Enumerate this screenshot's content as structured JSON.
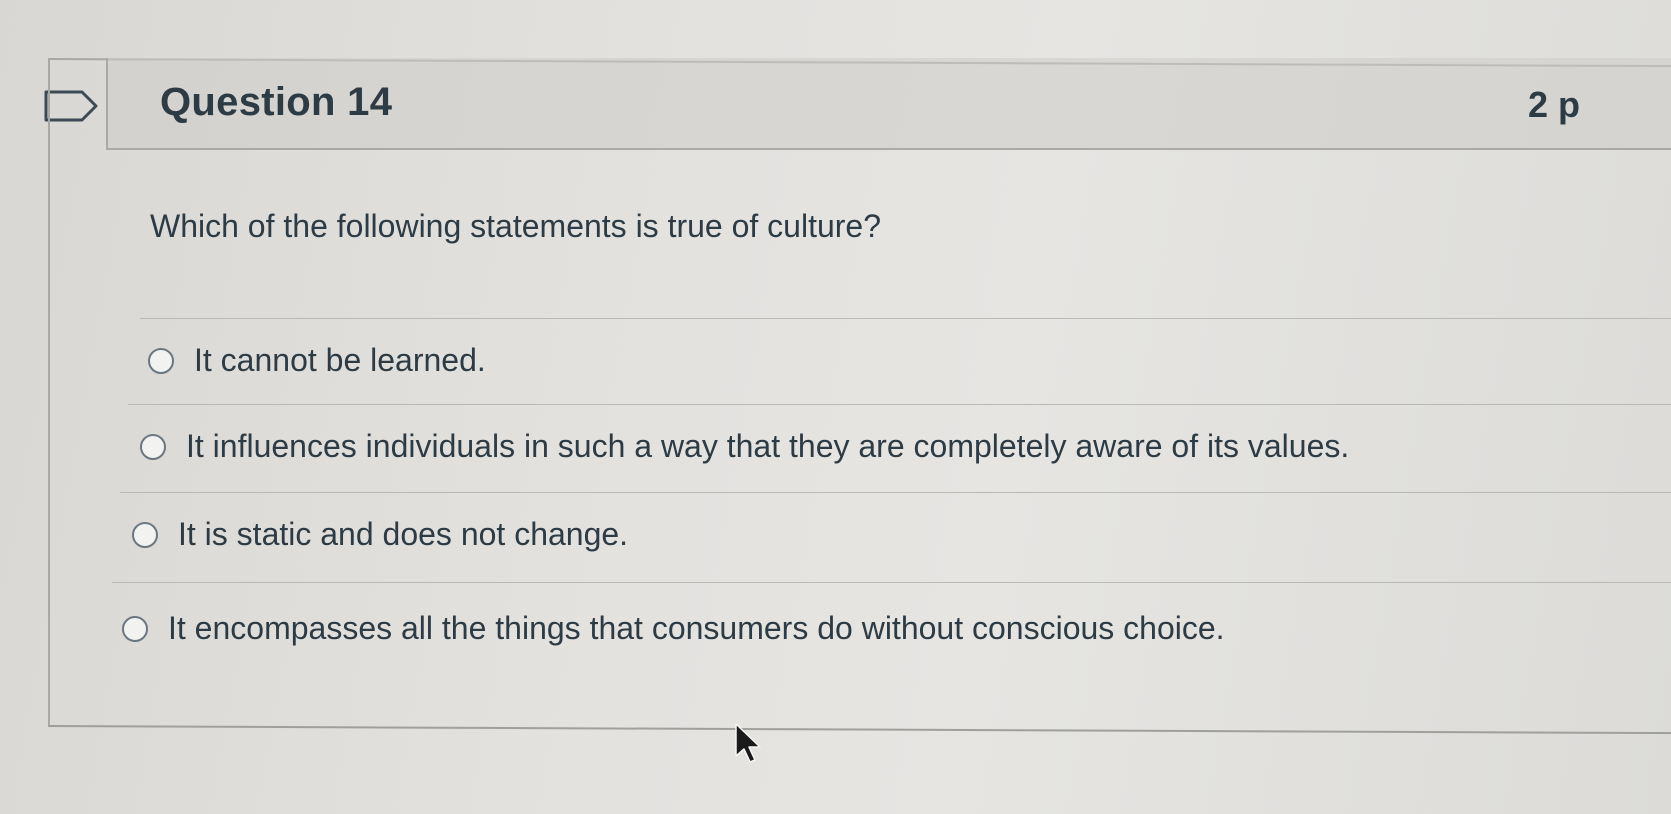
{
  "question": {
    "title": "Question 14",
    "points": "2 p",
    "text": "Which of the following statements is true of culture?"
  },
  "answers": [
    {
      "label": "It cannot be learned.",
      "selected": false
    },
    {
      "label": "It influences individuals in such a way that they are completely aware of its values.",
      "selected": false
    },
    {
      "label": "It is static and does not change.",
      "selected": false
    },
    {
      "label": "It encompasses all the things that consumers do without conscious choice.",
      "selected": false
    }
  ],
  "icons": {
    "flag": "flag-outline-icon",
    "cursor": "mouse-pointer-icon"
  },
  "colors": {
    "text": "#2d3b45",
    "header_bg": "#cdccc9",
    "border": "#a8a8a5"
  }
}
